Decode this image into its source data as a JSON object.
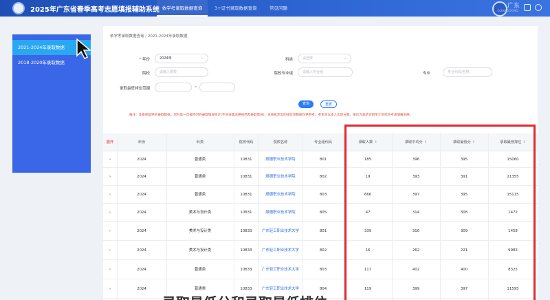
{
  "header": {
    "title": "2025年广东省春季高考志愿填报辅助系统",
    "tabs": [
      "依学考录取数据查询",
      "3+证书录取数据查询",
      "常见问题"
    ],
    "org_name": "广东",
    "org_sub": "GUANGDONG"
  },
  "sidebar": {
    "items": [
      {
        "label": "2021-2024年录取数据"
      },
      {
        "label": "2018-2020年录取数据"
      }
    ]
  },
  "breadcrumb": "依学考录取数据查询  /  2021-2024年录取数据",
  "form": {
    "year_label": "年份",
    "year_value": "2024年",
    "category_label": "科类",
    "category_placeholder": "请选择",
    "school_label": "院校",
    "school_placeholder": "请输入院校",
    "major_group_label": "院校专业组",
    "major_group_placeholder": "请输入专业组",
    "major_label": "专业",
    "major_placeholder": "专业代码/名称",
    "rank_label": "录取最低排位范围",
    "rank_from_placeholder": "",
    "rank_to_placeholder": "",
    "range_sep": "~",
    "search_btn": "查询",
    "reset_btn": "重置",
    "notice": "备注：本系统提供的录取数据，均为第一次投档时的录取情况统计(不含征集志愿投档及录取情况)，本系统涉及的排位等数据仅供参考，考生应以本人实际分数、排位为准结合招生计划综合考虑填报志愿。"
  },
  "table": {
    "headers": [
      "展开",
      "年份",
      "科类",
      "院校代码",
      "院校名称",
      "专业组代码",
      "录取人数",
      "录取平均分",
      "录取最低分",
      "录取最低排位"
    ],
    "rows": [
      {
        "expand": "›",
        "year": "2024",
        "category": "普通类",
        "code": "10831",
        "school": "顺德职业技术学院",
        "group": "801",
        "count": "185",
        "avg": "396",
        "min": "395",
        "rank": "15060"
      },
      {
        "expand": "›",
        "year": "2024",
        "category": "普通类",
        "code": "10831",
        "school": "顺德职业技术学院",
        "group": "802",
        "count": "19",
        "avg": "393",
        "min": "391",
        "rank": "21355"
      },
      {
        "expand": "›",
        "year": "2024",
        "category": "普通类",
        "code": "10831",
        "school": "顺德职业技术学院",
        "group": "803",
        "count": "666",
        "avg": "397",
        "min": "395",
        "rank": "15115"
      },
      {
        "expand": "›",
        "year": "2024",
        "category": "美术与设计类",
        "code": "10831",
        "school": "顺德职业技术学院",
        "group": "805",
        "count": "47",
        "avg": "314",
        "min": "308",
        "rank": "1472"
      },
      {
        "expand": "›",
        "year": "2024",
        "category": "美术与设计类",
        "code": "10833",
        "school": "广东轻工职业技术大学",
        "group": "801",
        "count": "339",
        "avg": "316",
        "min": "309",
        "rank": "1458"
      },
      {
        "expand": "›",
        "year": "2024",
        "category": "美术与设计类",
        "code": "10833",
        "school": "广东轻工职业技术大学",
        "group": "802",
        "count": "16",
        "avg": "262",
        "min": "221",
        "rank": "9983"
      },
      {
        "expand": "›",
        "year": "2024",
        "category": "普通类",
        "code": "10833",
        "school": "广东轻工职业技术大学",
        "group": "803",
        "count": "117",
        "avg": "402",
        "min": "400",
        "rank": "8325"
      },
      {
        "expand": "›",
        "year": "2024",
        "category": "普通类",
        "code": "10833",
        "school": "广东轻工职业技术大学",
        "group": "804",
        "count": "119",
        "avg": "399",
        "min": "397",
        "rank": "11595"
      }
    ]
  },
  "caption": "录取最低分和录取最低排位",
  "colors": {
    "accent": "#2d7cf6",
    "sidebar": "#3a66e8",
    "sidebar_active": "#2aa7f1",
    "highlight": "#e3262b"
  }
}
